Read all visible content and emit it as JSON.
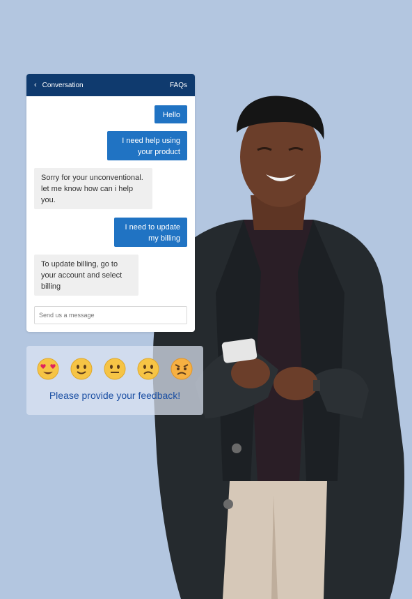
{
  "chat": {
    "header": {
      "back_icon": "‹",
      "title": "Conversation",
      "faqs": "FAQs"
    },
    "messages": [
      {
        "side": "out",
        "text": "Hello"
      },
      {
        "side": "out",
        "text": "I  need help using your product"
      },
      {
        "side": "in",
        "text": "Sorry for your unconventional. let me know how can i help you."
      },
      {
        "side": "out",
        "text": "I need to update my billing"
      },
      {
        "side": "in",
        "text": "To update billing, go to your account and select billing"
      }
    ],
    "input_placeholder": "Send us a message"
  },
  "feedback": {
    "emojis": [
      "heart-eyes-emoji",
      "slightly-smiling-emoji",
      "neutral-face-emoji",
      "frowning-face-emoji",
      "angry-face-emoji"
    ],
    "prompt": "Please provide your feedback!"
  },
  "colors": {
    "background": "#b3c6e0",
    "header": "#0f3a6e",
    "outgoing_bubble": "#2073c3",
    "incoming_bubble": "#efefef",
    "feedback_text": "#1b4fa3"
  }
}
